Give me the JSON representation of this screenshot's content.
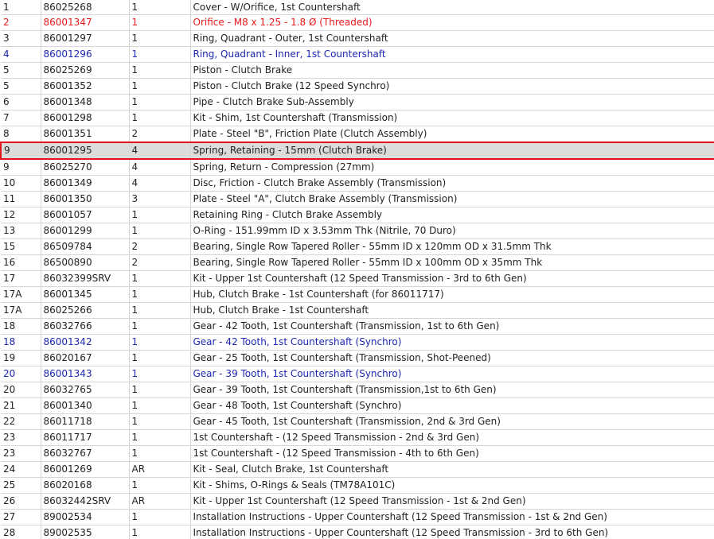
{
  "rows": [
    {
      "item": "1",
      "part": "86025268",
      "qty": "1",
      "desc": "Cover - W/Orifice, 1st Countershaft",
      "style": ""
    },
    {
      "item": "2",
      "part": "86001347",
      "qty": "1",
      "desc": "Orifice - M8 x 1.25 - 1.8 Ø (Threaded)",
      "style": "red"
    },
    {
      "item": "3",
      "part": "86001297",
      "qty": "1",
      "desc": "Ring, Quadrant - Outer, 1st Countershaft",
      "style": ""
    },
    {
      "item": "4",
      "part": "86001296",
      "qty": "1",
      "desc": "Ring, Quadrant - Inner, 1st Countershaft",
      "style": "blue"
    },
    {
      "item": "5",
      "part": "86025269",
      "qty": "1",
      "desc": "Piston - Clutch Brake",
      "style": ""
    },
    {
      "item": "5",
      "part": "86001352",
      "qty": "1",
      "desc": "Piston - Clutch Brake (12 Speed Synchro)",
      "style": ""
    },
    {
      "item": "6",
      "part": "86001348",
      "qty": "1",
      "desc": "Pipe - Clutch Brake Sub-Assembly",
      "style": ""
    },
    {
      "item": "7",
      "part": "86001298",
      "qty": "1",
      "desc": "Kit - Shim, 1st Countershaft (Transmission)",
      "style": ""
    },
    {
      "item": "8",
      "part": "86001351",
      "qty": "2",
      "desc": "Plate - Steel \"B\", Friction Plate (Clutch Assembly)",
      "style": ""
    },
    {
      "item": "9",
      "part": "86001295",
      "qty": "4",
      "desc": "Spring, Retaining - 15mm (Clutch Brake)",
      "style": "selected"
    },
    {
      "item": "9",
      "part": "86025270",
      "qty": "4",
      "desc": "Spring, Return - Compression (27mm)",
      "style": ""
    },
    {
      "item": "10",
      "part": "86001349",
      "qty": "4",
      "desc": "Disc, Friction - Clutch Brake Assembly (Transmission)",
      "style": ""
    },
    {
      "item": "11",
      "part": "86001350",
      "qty": "3",
      "desc": "Plate - Steel \"A\", Clutch Brake Assembly (Transmission)",
      "style": ""
    },
    {
      "item": "12",
      "part": "86001057",
      "qty": "1",
      "desc": "Retaining Ring - Clutch Brake Assembly",
      "style": ""
    },
    {
      "item": "13",
      "part": "86001299",
      "qty": "1",
      "desc": "O-Ring - 151.99mm ID x 3.53mm Thk (Nitrile, 70 Duro)",
      "style": ""
    },
    {
      "item": "15",
      "part": "86509784",
      "qty": "2",
      "desc": "Bearing, Single Row Tapered Roller - 55mm ID x 120mm OD x 31.5mm Thk",
      "style": ""
    },
    {
      "item": "16",
      "part": "86500890",
      "qty": "2",
      "desc": "Bearing, Single Row Tapered Roller - 55mm ID x 100mm OD x 35mm Thk",
      "style": ""
    },
    {
      "item": "17",
      "part": "86032399SRV",
      "qty": "1",
      "desc": "Kit - Upper 1st Countershaft (12 Speed Transmission - 3rd to 6th Gen)",
      "style": ""
    },
    {
      "item": "17A",
      "part": "86001345",
      "qty": "1",
      "desc": "Hub, Clutch Brake - 1st Countershaft (for 86011717)",
      "style": ""
    },
    {
      "item": "17A",
      "part": "86025266",
      "qty": "1",
      "desc": "Hub, Clutch Brake - 1st Countershaft",
      "style": ""
    },
    {
      "item": "18",
      "part": "86032766",
      "qty": "1",
      "desc": "Gear - 42 Tooth, 1st Countershaft (Transmission, 1st to 6th Gen)",
      "style": ""
    },
    {
      "item": "18",
      "part": "86001342",
      "qty": "1",
      "desc": "Gear - 42 Tooth, 1st Countershaft (Synchro)",
      "style": "blue"
    },
    {
      "item": "19",
      "part": "86020167",
      "qty": "1",
      "desc": "Gear - 25 Tooth, 1st Countershaft (Transmission, Shot-Peened)",
      "style": ""
    },
    {
      "item": "20",
      "part": "86001343",
      "qty": "1",
      "desc": "Gear - 39 Tooth, 1st Countershaft (Synchro)",
      "style": "blue"
    },
    {
      "item": "20",
      "part": "86032765",
      "qty": "1",
      "desc": "Gear - 39 Tooth, 1st Countershaft (Transmission,1st to 6th Gen)",
      "style": ""
    },
    {
      "item": "21",
      "part": "86001340",
      "qty": "1",
      "desc": "Gear - 48 Tooth, 1st Countershaft (Synchro)",
      "style": ""
    },
    {
      "item": "22",
      "part": "86011718",
      "qty": "1",
      "desc": "Gear - 45 Tooth, 1st Countershaft (Transmission, 2nd & 3rd Gen)",
      "style": ""
    },
    {
      "item": "23",
      "part": "86011717",
      "qty": "1",
      "desc": "1st Countershaft - (12 Speed Transmission - 2nd & 3rd Gen)",
      "style": ""
    },
    {
      "item": "23",
      "part": "86032767",
      "qty": "1",
      "desc": "1st Countershaft - (12 Speed Transmission - 4th to 6th Gen)",
      "style": ""
    },
    {
      "item": "24",
      "part": "86001269",
      "qty": "AR",
      "desc": "Kit - Seal, Clutch Brake, 1st Countershaft",
      "style": ""
    },
    {
      "item": "25",
      "part": "86020168",
      "qty": "1",
      "desc": "Kit - Shims, O-Rings & Seals (TM78A101C)",
      "style": ""
    },
    {
      "item": "26",
      "part": "86032442SRV",
      "qty": "AR",
      "desc": "Kit - Upper 1st Countershaft (12 Speed Transmission - 1st & 2nd Gen)",
      "style": ""
    },
    {
      "item": "27",
      "part": "89002534",
      "qty": "1",
      "desc": "Installation Instructions - Upper Countershaft (12 Speed Transmission - 1st & 2nd Gen)",
      "style": ""
    },
    {
      "item": "28",
      "part": "89002535",
      "qty": "1",
      "desc": "Installation Instructions - Upper Countershaft (12 Speed Transmission - 3rd to 6th Gen)",
      "style": ""
    }
  ],
  "colors": {
    "red_text": "#e8181c",
    "blue_text": "#1c27b3",
    "highlight_border": "#e0161c",
    "highlight_fill": "#dcdcdc",
    "grid": "#d6d6d6"
  }
}
